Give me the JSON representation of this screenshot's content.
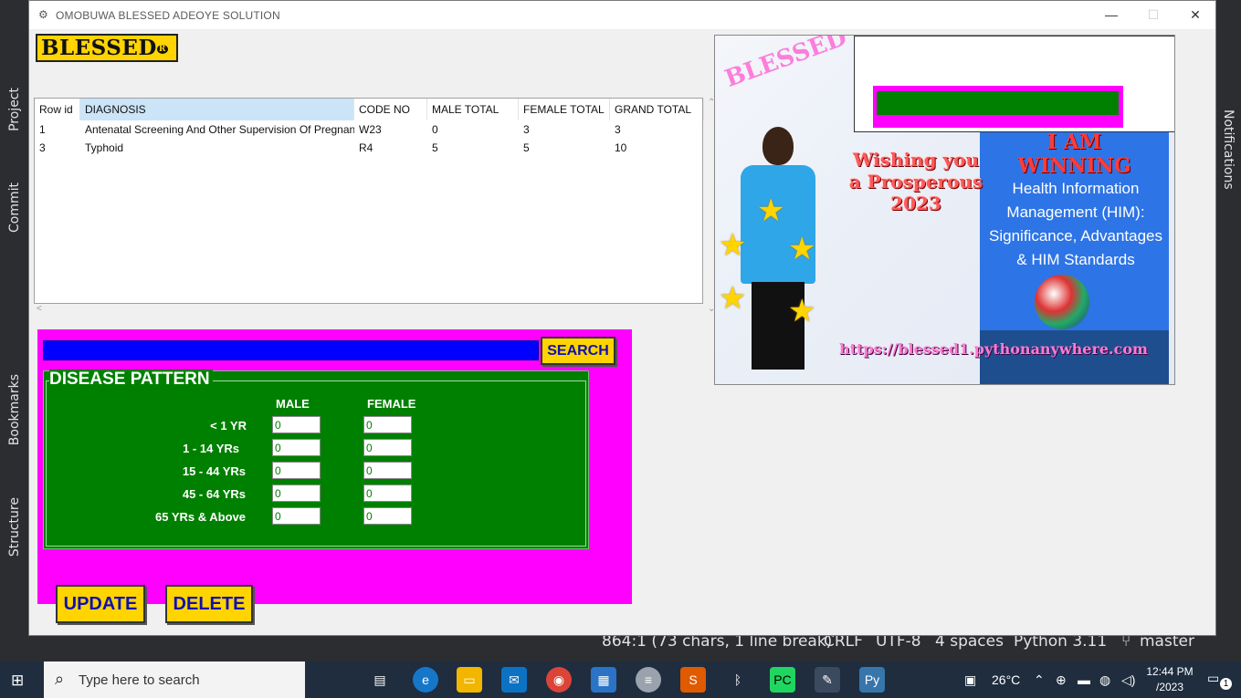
{
  "window": {
    "title": "OMOBUWA BLESSED ADEOYE SOLUTION",
    "minimize": "—",
    "maximize": "☐",
    "close": "✕"
  },
  "logo": {
    "text": "BLESSED",
    "mark": "R"
  },
  "table": {
    "headers": [
      "Row id",
      "DIAGNOSIS",
      "CODE NO",
      "MALE TOTAL",
      "FEMALE TOTAL",
      "GRAND TOTAL"
    ],
    "rows": [
      [
        "1",
        "Antenatal Screening And Other Supervision Of Pregnan",
        "W23",
        "0",
        "3",
        "3"
      ],
      [
        "3",
        "Typhoid",
        "R4",
        "5",
        "5",
        "10"
      ]
    ]
  },
  "search": {
    "value": "",
    "button": "SEARCH"
  },
  "disease_pattern": {
    "title": "DISEASE PATTERN",
    "col_male": "MALE",
    "col_female": "FEMALE",
    "rows": [
      {
        "label": "< 1 YR",
        "male": "0",
        "female": "0"
      },
      {
        "label": "1 - 14 YRs",
        "male": "0",
        "female": "0"
      },
      {
        "label": "15 - 44 YRs",
        "male": "0",
        "female": "0"
      },
      {
        "label": "45 - 64 YRs",
        "male": "0",
        "female": "0"
      },
      {
        "label": "65 YRs & Above",
        "male": "0",
        "female": "0"
      }
    ]
  },
  "actions": {
    "update": "UPDATE",
    "delete": "DELETE"
  },
  "banner": {
    "arc_text": "BLESSED",
    "wish_line1": "Wishing you",
    "wish_line2": "a Prosperous",
    "wish_line3": "2023",
    "winning_line1": "I AM",
    "winning_line2": "WINNING",
    "him_text": "Health Information Management (HIM): Significance, Advantages & HIM Standards",
    "url": "https://blessed1.pythonanywhere.com"
  },
  "ide": {
    "left_tabs": [
      "Project",
      "Commit",
      "Bookmarks",
      "Structure"
    ],
    "right_tab": "Notifications",
    "status": {
      "position": "864:1 (73 chars, 1 line break)",
      "line_sep": "CRLF",
      "encoding": "UTF-8",
      "indent": "4 spaces",
      "interpreter": "Python 3.11",
      "branch": "master"
    }
  },
  "taskbar": {
    "search_placeholder": "Type here to search",
    "weather": "26°C",
    "time": "12:44 PM",
    "date": "/2023",
    "notification_count": "1"
  }
}
